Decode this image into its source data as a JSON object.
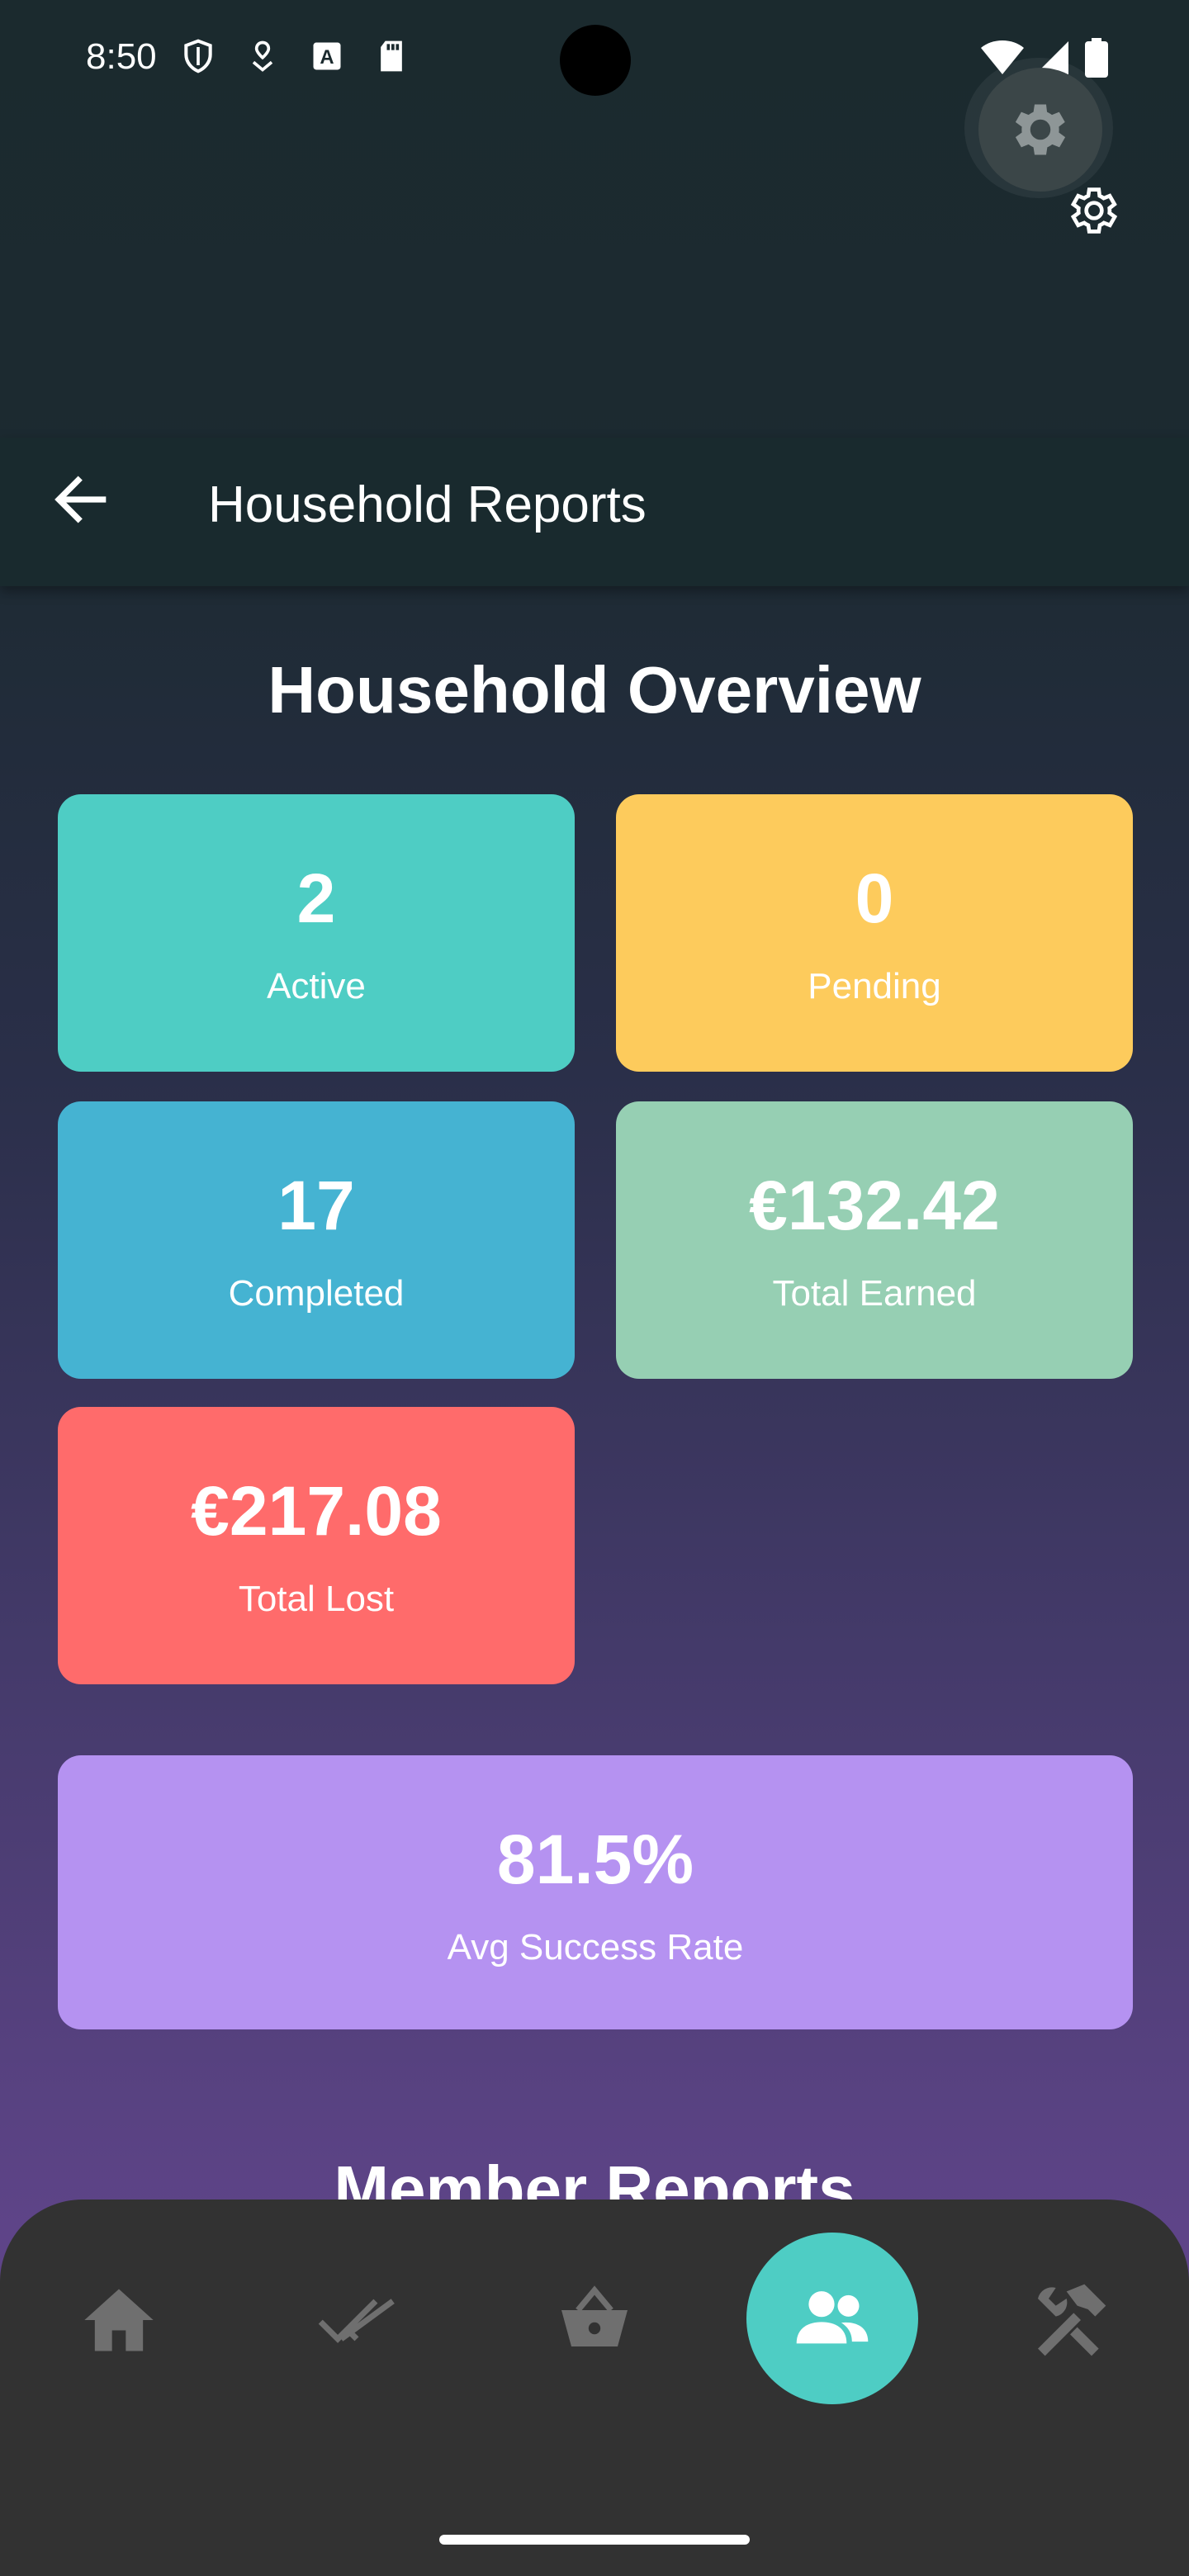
{
  "status_bar": {
    "time": "8:50",
    "icons_left": [
      "shield-icon",
      "location-pin-icon",
      "a-badge-icon",
      "sd-card-icon"
    ],
    "icons_right": [
      "wifi-icon",
      "cell-signal-icon",
      "battery-icon"
    ]
  },
  "header": {
    "title": "Household Reports",
    "back_icon": "arrow-left-icon",
    "settings_icon": "gear-icon"
  },
  "overview": {
    "title": "Household Overview",
    "cards": [
      {
        "value": "2",
        "label": "Active",
        "color": "#4ecdc4"
      },
      {
        "value": "0",
        "label": "Pending",
        "color": "#fdcb5c"
      },
      {
        "value": "17",
        "label": "Completed",
        "color": "#45b3d2"
      },
      {
        "value": "€132.42",
        "label": "Total Earned",
        "color": "#96cfb3"
      },
      {
        "value": "€217.08",
        "label": "Total Lost",
        "color": "#ff6b6b"
      },
      {
        "value": "81.5%",
        "label": "Avg Success Rate",
        "color": "#b592f1"
      }
    ]
  },
  "member_reports": {
    "title": "Member Reports"
  },
  "bottom_nav": {
    "items": [
      {
        "icon": "home-icon"
      },
      {
        "icon": "double-check-icon"
      },
      {
        "icon": "basket-icon"
      },
      {
        "icon": "people-icon",
        "active": true
      },
      {
        "icon": "tools-icon"
      }
    ],
    "active_color": "#4ecdc4"
  }
}
